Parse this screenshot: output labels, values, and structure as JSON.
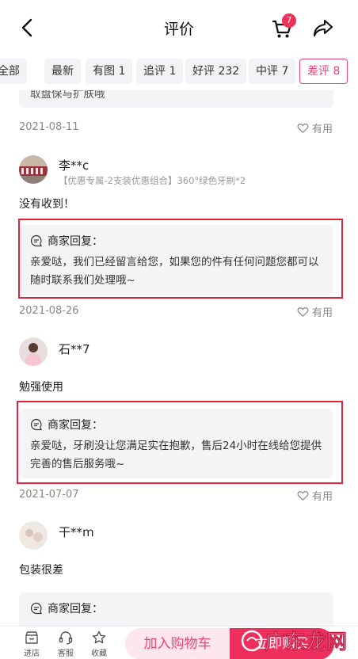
{
  "header": {
    "title": "评价",
    "cart_badge": "7"
  },
  "filters": [
    {
      "label": "全部"
    },
    {
      "label": "最新"
    },
    {
      "label": "有图 1"
    },
    {
      "label": "追评 1"
    },
    {
      "label": "好评 232"
    },
    {
      "label": "中评 7"
    },
    {
      "label": "差评 8",
      "active": true
    }
  ],
  "reviews": [
    {
      "partial_reply": "取盘保与扩肤哦",
      "date": "2021-08-11",
      "useful": "有用"
    },
    {
      "user": "李**c",
      "spec": "【优惠专属-2支装优惠组合】360°绿色牙刷*2",
      "comment": "没有收到！",
      "reply_title": "商家回复：",
      "reply": "亲爱哒，我们已经留言给您，如果您的件有任何问题您都可以随时联系我们处理哦~",
      "date": "2021-08-26",
      "useful": "有用"
    },
    {
      "user": "石**7",
      "comment": "勉强使用",
      "reply_title": "商家回复：",
      "reply": "亲爱哒，牙刷没让您满足实在抱歉，售后24小时在线给您提供完善的售后服务哦~",
      "date": "2021-07-07",
      "useful": "有用"
    },
    {
      "user": "干**m",
      "comment": "包装很差",
      "reply_title": "商家回复："
    }
  ],
  "bottom": {
    "store": "进店",
    "service": "客服",
    "favorite": "收藏",
    "add_cart": "加入购物车",
    "buy_now": "立即购买"
  },
  "watermark": "广东龙网",
  "colors": {
    "accent": "#e8447a",
    "buy": "#ee2e5d",
    "highlight": "#e0243a"
  }
}
